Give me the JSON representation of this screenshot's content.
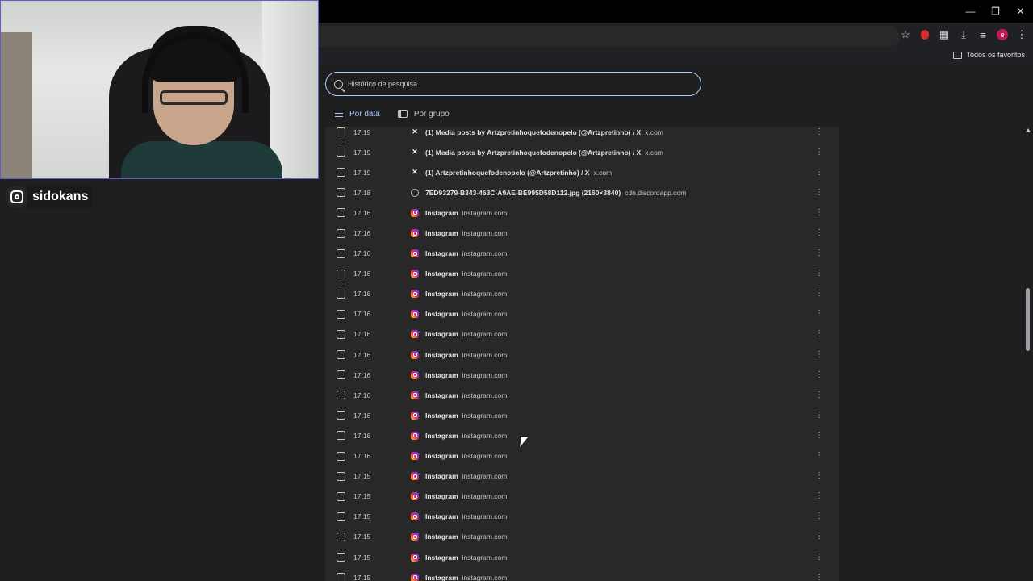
{
  "stream": {
    "social_handle": "sidokans"
  },
  "browser": {
    "bookmarks": {
      "all_favorites": "Todos os favoritos"
    },
    "profile_initial": "e"
  },
  "history": {
    "search_placeholder": "Histórico de pesquisa",
    "tabs": [
      {
        "label": "Por data"
      },
      {
        "label": "Por grupo"
      }
    ],
    "rows": [
      {
        "time": "17:19",
        "icon": "x-icon",
        "title": "(1) Media posts by Artzpretinhoquefodenopelo (@Artzpretinho) / X",
        "domain": "x.com"
      },
      {
        "time": "17:19",
        "icon": "x-icon",
        "title": "(1) Media posts by Artzpretinhoquefodenopelo (@Artzpretinho) / X",
        "domain": "x.com"
      },
      {
        "time": "17:19",
        "icon": "x-icon",
        "title": "(1) Artzpretinhoquefodenopelo (@Artzpretinho) / X",
        "domain": "x.com"
      },
      {
        "time": "17:18",
        "icon": "globe-icon",
        "title": "7ED93279-B343-463C-A9AE-BE995D58D112.jpg (2160×3840)",
        "domain": "cdn.discordapp.com"
      },
      {
        "time": "17:16",
        "icon": "instagram-icon",
        "title": "Instagram",
        "domain": "instagram.com"
      },
      {
        "time": "17:16",
        "icon": "instagram-icon",
        "title": "Instagram",
        "domain": "instagram.com"
      },
      {
        "time": "17:16",
        "icon": "instagram-icon",
        "title": "Instagram",
        "domain": "instagram.com"
      },
      {
        "time": "17:16",
        "icon": "instagram-icon",
        "title": "Instagram",
        "domain": "instagram.com"
      },
      {
        "time": "17:16",
        "icon": "instagram-icon",
        "title": "Instagram",
        "domain": "instagram.com"
      },
      {
        "time": "17:16",
        "icon": "instagram-icon",
        "title": "Instagram",
        "domain": "instagram.com"
      },
      {
        "time": "17:16",
        "icon": "instagram-icon",
        "title": "Instagram",
        "domain": "instagram.com"
      },
      {
        "time": "17:16",
        "icon": "instagram-icon",
        "title": "Instagram",
        "domain": "instagram.com"
      },
      {
        "time": "17:16",
        "icon": "instagram-icon",
        "title": "Instagram",
        "domain": "instagram.com"
      },
      {
        "time": "17:16",
        "icon": "instagram-icon",
        "title": "Instagram",
        "domain": "instagram.com"
      },
      {
        "time": "17:16",
        "icon": "instagram-icon",
        "title": "Instagram",
        "domain": "instagram.com"
      },
      {
        "time": "17:16",
        "icon": "instagram-icon",
        "title": "Instagram",
        "domain": "instagram.com"
      },
      {
        "time": "17:16",
        "icon": "instagram-icon",
        "title": "Instagram",
        "domain": "instagram.com"
      },
      {
        "time": "17:15",
        "icon": "instagram-icon",
        "title": "Instagram",
        "domain": "instagram.com"
      },
      {
        "time": "17:15",
        "icon": "instagram-icon",
        "title": "Instagram",
        "domain": "instagram.com"
      },
      {
        "time": "17:15",
        "icon": "instagram-icon",
        "title": "Instagram",
        "domain": "instagram.com"
      },
      {
        "time": "17:15",
        "icon": "instagram-icon",
        "title": "Instagram",
        "domain": "instagram.com"
      },
      {
        "time": "17:15",
        "icon": "instagram-icon",
        "title": "Instagram",
        "domain": "instagram.com"
      },
      {
        "time": "17:15",
        "icon": "instagram-icon",
        "title": "Instagram",
        "domain": "instagram.com"
      }
    ]
  },
  "colors": {
    "accent": "#a8c7fa",
    "background": "#1f1f1f",
    "card": "#282828"
  }
}
